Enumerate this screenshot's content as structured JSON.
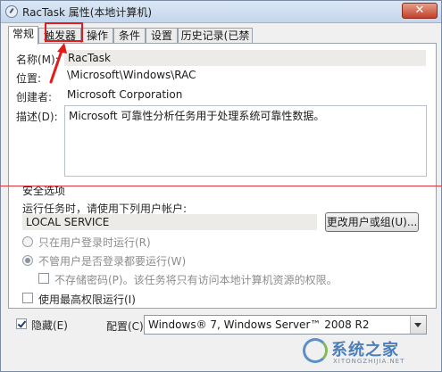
{
  "window": {
    "title": "RacTask 属性(本地计算机)",
    "close_label": "✕"
  },
  "tabs": [
    {
      "label": "常规",
      "active": true
    },
    {
      "label": "触发器",
      "active": false
    },
    {
      "label": "操作",
      "active": false
    },
    {
      "label": "条件",
      "active": false
    },
    {
      "label": "设置",
      "active": false
    },
    {
      "label": "历史记录(已禁用)",
      "active": false
    }
  ],
  "general": {
    "name_label": "名称(M):",
    "name_value": "RacTask",
    "location_label": "位置:",
    "location_value": "\\Microsoft\\Windows\\RAC",
    "author_label": "创建者:",
    "author_value": "Microsoft Corporation",
    "description_label": "描述(D):",
    "description_value": "Microsoft 可靠性分析任务用于处理系统可靠性数据。"
  },
  "security": {
    "group_title": "安全选项",
    "run_as_prompt": "运行任务时，请使用下列用户帐户:",
    "account_value": "LOCAL SERVICE",
    "change_user_button": "更改用户或组(U)...",
    "radio_logged_on": "只在用户登录时运行(R)",
    "radio_whether_logged": "不管用户是否登录都要运行(W)",
    "check_no_store_password": "不存储密码(P)。该任务将只有访问本地计算机资源的权限。",
    "check_highest_privileges": "使用最高权限运行(I)"
  },
  "footer": {
    "hidden_label": "隐藏(E)",
    "hidden_checked": true,
    "configure_label": "配置(C):",
    "configure_value": "Windows® 7, Windows Server™ 2008 R2"
  },
  "watermark": {
    "brand": "系统之家",
    "url": "XITONGZHIJIA.NET"
  },
  "colors": {
    "annotation": "#e21b1b",
    "titlebar": "#c4d6ec",
    "watermark": "#4c7fba"
  }
}
